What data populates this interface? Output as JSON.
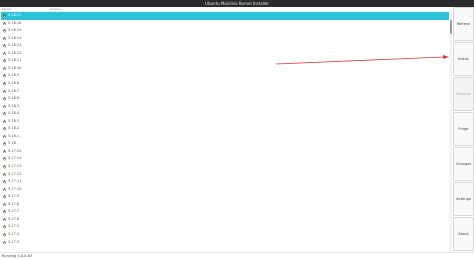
{
  "window": {
    "title": "Ubuntu Mainline Kernel Installer"
  },
  "columns": {
    "kernel": "Kernel",
    "version": "Version"
  },
  "kernels": [
    "5.18.17",
    "5.18.16",
    "5.18.15",
    "5.18.14",
    "5.18.13",
    "5.18.12",
    "5.18.11",
    "5.18.10",
    "5.18.9",
    "5.18.8",
    "5.18.7",
    "5.18.6",
    "5.18.5",
    "5.18.4",
    "5.18.3",
    "5.18.2",
    "5.18.1",
    "5.18",
    "5.17.15",
    "5.17.14",
    "5.17.13",
    "5.17.12",
    "5.17.11",
    "5.17.10",
    "5.17.9",
    "5.17.8",
    "5.17.7",
    "5.17.6",
    "5.17.5",
    "5.17.4",
    "5.17.3"
  ],
  "selected_index": 0,
  "sidebar": {
    "refresh": "Refresh",
    "install": "Install",
    "remove": "Remove",
    "purge": "Purge",
    "changes": "Changes",
    "settings": "Settings",
    "about": "About"
  },
  "status": {
    "text": "Running 5.8.0-63"
  },
  "icons": {
    "kernel": "tux-icon"
  },
  "colors": {
    "selection": "#2ac3d9",
    "arrow": "#e0303a"
  }
}
